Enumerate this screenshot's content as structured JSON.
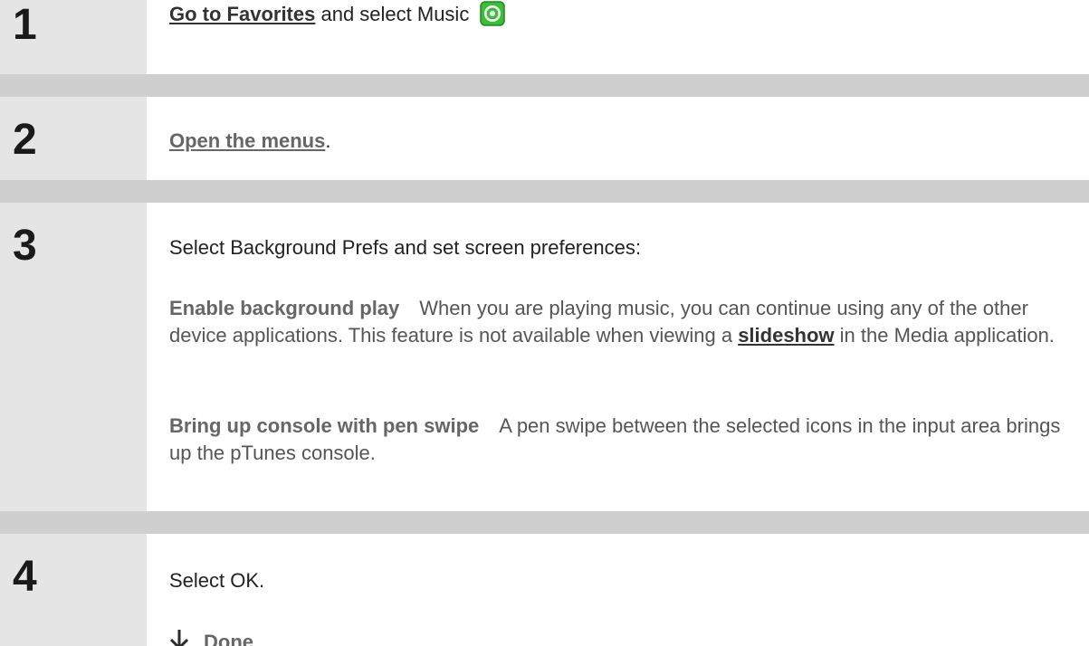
{
  "steps": [
    {
      "number": "1",
      "link": "Go to Favorites",
      "text_after_link": " and select Music",
      "icon": "music-app-icon"
    },
    {
      "number": "2",
      "link": "Open the menus",
      "text_after_link": "."
    },
    {
      "number": "3",
      "intro": "Select Background Prefs and set screen preferences:",
      "options": [
        {
          "term": "Enable background play",
          "desc_before_link": "When you are playing music, you can continue using any of the other device applications. This feature is not available when viewing a ",
          "link": "slideshow",
          "desc_after_link": " in the Media application."
        },
        {
          "term": "Bring up console with pen swipe",
          "desc": "A pen swipe between the selected icons in the input area brings up the pTunes console."
        }
      ]
    },
    {
      "number": "4",
      "text": "Select OK.",
      "done_label": "Done",
      "done_icon": "down-arrow-icon"
    }
  ],
  "colors": {
    "number_column": "#e5e5e5",
    "separator": "#cfcfcf",
    "icon_green": "#3bbf3b"
  }
}
